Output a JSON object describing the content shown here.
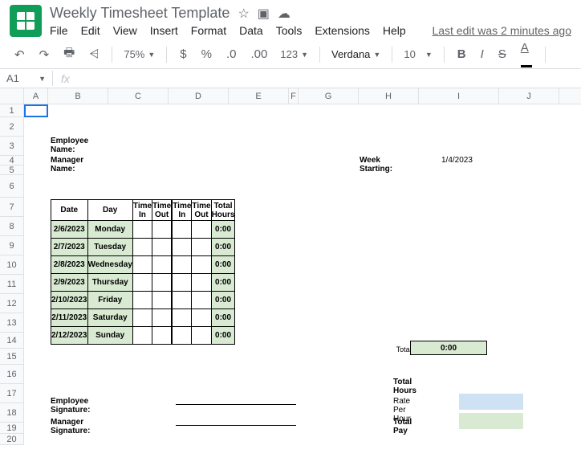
{
  "doc": {
    "title": "Weekly Timesheet Template"
  },
  "menu": {
    "file": "File",
    "edit": "Edit",
    "view": "View",
    "insert": "Insert",
    "format": "Format",
    "data": "Data",
    "tools": "Tools",
    "extensions": "Extensions",
    "help": "Help",
    "last_edit": "Last edit was 2 minutes ago"
  },
  "toolbar": {
    "zoom": "75%",
    "font": "Verdana",
    "size": "10"
  },
  "formula": {
    "cell": "A1",
    "fx": "fx"
  },
  "cols": {
    "A": "A",
    "B": "B",
    "C": "C",
    "D": "D",
    "E": "E",
    "F": "F",
    "G": "G",
    "H": "H",
    "I": "I",
    "J": "J"
  },
  "rows": [
    "1",
    "2",
    "3",
    "4",
    "5",
    "6",
    "7",
    "8",
    "9",
    "10",
    "11",
    "12",
    "13",
    "14",
    "15",
    "16",
    "17",
    "18",
    "19",
    "20"
  ],
  "sheet": {
    "employee_name_label": "Employee Name:",
    "manager_name_label": "Manager Name:",
    "week_starting_label": "Week Starting:",
    "week_starting_value": "1/4/2023",
    "headers": {
      "date": "Date",
      "day": "Day",
      "time_in": "Time In",
      "time_out": "Time Out",
      "total_hours": "Total Hours"
    },
    "entries": [
      {
        "date": "2/6/2023",
        "day": "Monday",
        "total": "0:00"
      },
      {
        "date": "2/7/2023",
        "day": "Tuesday",
        "total": "0:00"
      },
      {
        "date": "2/8/2023",
        "day": "Wednesday",
        "total": "0:00"
      },
      {
        "date": "2/9/2023",
        "day": "Thursday",
        "total": "0:00"
      },
      {
        "date": "2/10/2023",
        "day": "Friday",
        "total": "0:00"
      },
      {
        "date": "2/11/2023",
        "day": "Saturday",
        "total": "0:00"
      },
      {
        "date": "2/12/2023",
        "day": "Sunday",
        "total": "0:00"
      }
    ],
    "total_hours_week_label": "Total Hours (This Week)",
    "total_hours_week_value": "0:00",
    "employee_signature_label": "Employee Signature:",
    "manager_signature_label": "Manager Signature:",
    "summary_total_hours": "Total Hours",
    "summary_rate": "Rate Per Hour",
    "summary_total_pay": "Total Pay"
  }
}
